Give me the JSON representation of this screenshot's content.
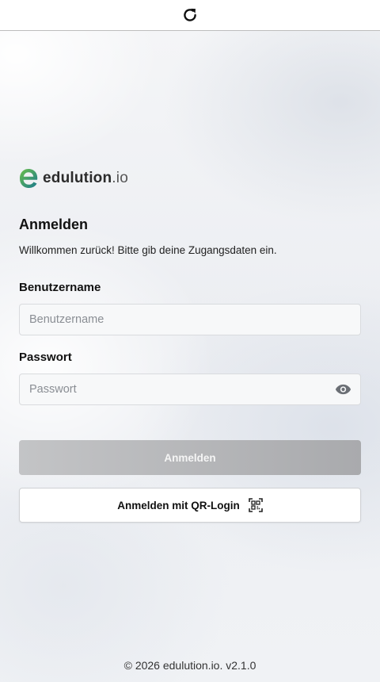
{
  "topbar": {
    "reload_icon": "reload-icon"
  },
  "brand": {
    "name": "edulution",
    "tld": ".io",
    "colors": {
      "green": "#5bb14a",
      "teal": "#1f7c8c"
    }
  },
  "login": {
    "title": "Anmelden",
    "subtitle": "Willkommen zurück! Bitte gib deine Zugangsdaten ein.",
    "username": {
      "label": "Benutzername",
      "placeholder": "Benutzername",
      "value": ""
    },
    "password": {
      "label": "Passwort",
      "placeholder": "Passwort",
      "value": "",
      "toggle_icon": "eye-icon"
    },
    "submit_label": "Anmelden",
    "qr_label": "Anmelden mit QR-Login",
    "qr_icon": "qr-scan-icon"
  },
  "footer": {
    "text": "© 2026 edulution.io. v2.1.0"
  }
}
